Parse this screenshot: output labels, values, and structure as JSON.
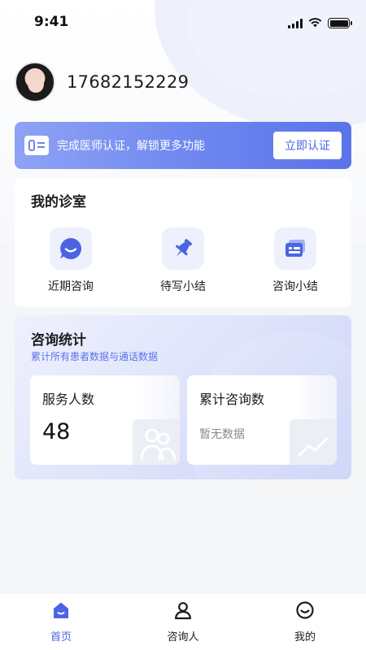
{
  "status_bar": {
    "time": "9:41"
  },
  "profile": {
    "phone": "17682152229"
  },
  "banner": {
    "text": "完成医师认证，解锁更多功能",
    "button": "立即认证"
  },
  "clinic": {
    "title": "我的诊室",
    "items": [
      {
        "label": "近期咨询",
        "icon": "chat-smile-icon"
      },
      {
        "label": "待写小结",
        "icon": "pushpin-icon"
      },
      {
        "label": "咨询小结",
        "icon": "document-card-icon"
      }
    ]
  },
  "stats": {
    "title": "咨询统计",
    "subtitle": "累计所有患者数据与通话数据",
    "served": {
      "label": "服务人数",
      "value": "48"
    },
    "total": {
      "label": "累计咨询数",
      "empty": "暂无数据"
    }
  },
  "tabbar": {
    "items": [
      {
        "label": "首页",
        "icon": "home-icon",
        "active": true
      },
      {
        "label": "咨询人",
        "icon": "person-icon",
        "active": false
      },
      {
        "label": "我的",
        "icon": "smile-icon",
        "active": false
      }
    ]
  },
  "colors": {
    "accent": "#5a73ea",
    "banner_start": "#8ea3f5",
    "banner_end": "#5a73ea"
  }
}
